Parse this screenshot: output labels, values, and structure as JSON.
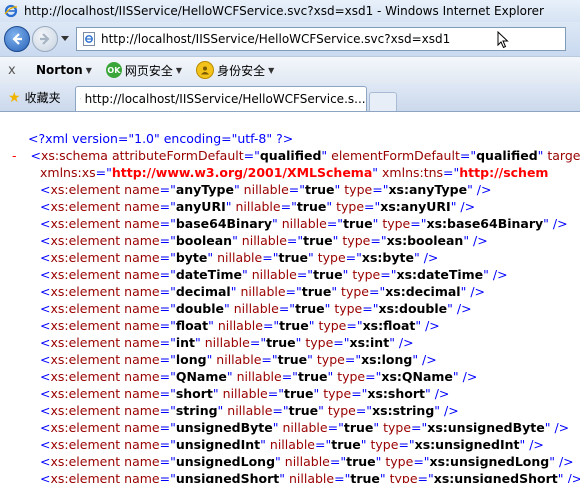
{
  "window": {
    "title": "http://localhost/IISService/HelloWCFService.svc?xsd=xsd1 - Windows Internet Explorer"
  },
  "navigation": {
    "address": "http://localhost/IISService/HelloWCFService.svc?xsd=xsd1"
  },
  "toolbar": {
    "close_glyph": "x",
    "norton_label": "Norton",
    "web_safety_label": "网页安全",
    "web_safety_badge": "OK",
    "identity_safety_label": "身份安全"
  },
  "tabs": {
    "favorites_label": "收藏夹",
    "active_tab_label": "http://localhost/IISService/HelloWCFService.s..."
  },
  "xml": {
    "decl": "<?xml version=\"1.0\" encoding=\"utf-8\" ?>",
    "collapse_glyph": "-",
    "schema_open_tag": "xs:schema",
    "schema_attr1_name": "attributeFormDefault",
    "schema_attr1_value": "qualified",
    "schema_attr2_name": "elementFormDefault",
    "schema_attr2_value": "qualified",
    "schema_attr3_name": "targe",
    "xmlns_xs_name": "xmlns:xs",
    "xmlns_xs_value": "http://www.w3.org/2001/XMLSchema",
    "xmlns_tns_name": "xmlns:tns",
    "xmlns_tns_value": "http://schem",
    "element_tag": "xs:element",
    "name_attr": "name",
    "nillable_attr": "nillable",
    "type_attr": "type",
    "true_value": "true",
    "elements": [
      {
        "name": "anyType",
        "type": "xs:anyType"
      },
      {
        "name": "anyURI",
        "type": "xs:anyURI"
      },
      {
        "name": "base64Binary",
        "type": "xs:base64Binary"
      },
      {
        "name": "boolean",
        "type": "xs:boolean"
      },
      {
        "name": "byte",
        "type": "xs:byte"
      },
      {
        "name": "dateTime",
        "type": "xs:dateTime"
      },
      {
        "name": "decimal",
        "type": "xs:decimal"
      },
      {
        "name": "double",
        "type": "xs:double"
      },
      {
        "name": "float",
        "type": "xs:float"
      },
      {
        "name": "int",
        "type": "xs:int"
      },
      {
        "name": "long",
        "type": "xs:long"
      },
      {
        "name": "QName",
        "type": "xs:QName"
      },
      {
        "name": "short",
        "type": "xs:short"
      },
      {
        "name": "string",
        "type": "xs:string"
      },
      {
        "name": "unsignedByte",
        "type": "xs:unsignedByte"
      },
      {
        "name": "unsignedInt",
        "type": "xs:unsignedInt"
      },
      {
        "name": "unsignedLong",
        "type": "xs:unsignedLong"
      },
      {
        "name": "unsignedShort",
        "type": "xs:unsignedShort"
      }
    ]
  }
}
